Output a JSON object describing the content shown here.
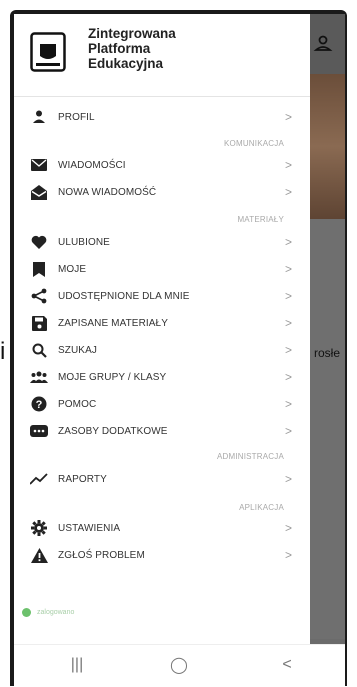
{
  "app": {
    "title": "Zintegrowana\nPlatforma\nEdukacyjna"
  },
  "background": {
    "side_letter": "i",
    "peek_text": "rosłe"
  },
  "sections": {
    "komunikacja": "KOMUNIKACJA",
    "materialy": "MATERIAŁY",
    "administracja": "ADMINISTRACJA",
    "aplikacja": "APLIKACJA"
  },
  "menu": {
    "profil": "PROFIL",
    "wiadomosci": "WIADOMOŚCI",
    "nowa_wiadomosc": "NOWA WIADOMOŚĆ",
    "ulubione": "ULUBIONE",
    "moje": "MOJE",
    "udostepnione": "UDOSTĘPNIONE DLA MNIE",
    "zapisane": "ZAPISANE MATERIAŁY",
    "szukaj": "SZUKAJ",
    "grupy": "MOJE GRUPY / KLASY",
    "pomoc": "POMOC",
    "zasoby": "ZASOBY DODATKOWE",
    "raporty": "RAPORTY",
    "ustawienia": "USTAWIENIA",
    "zglos": "ZGŁOŚ PROBLEM"
  },
  "chevron": ">",
  "status": {
    "text": "zalogowano",
    "color": "#6cc16c"
  },
  "navbar": {
    "recent": "|||",
    "home": "◯",
    "back": "<"
  },
  "colors": {
    "text": "#333333",
    "section": "#a9a9a9",
    "icon": "#222222"
  }
}
